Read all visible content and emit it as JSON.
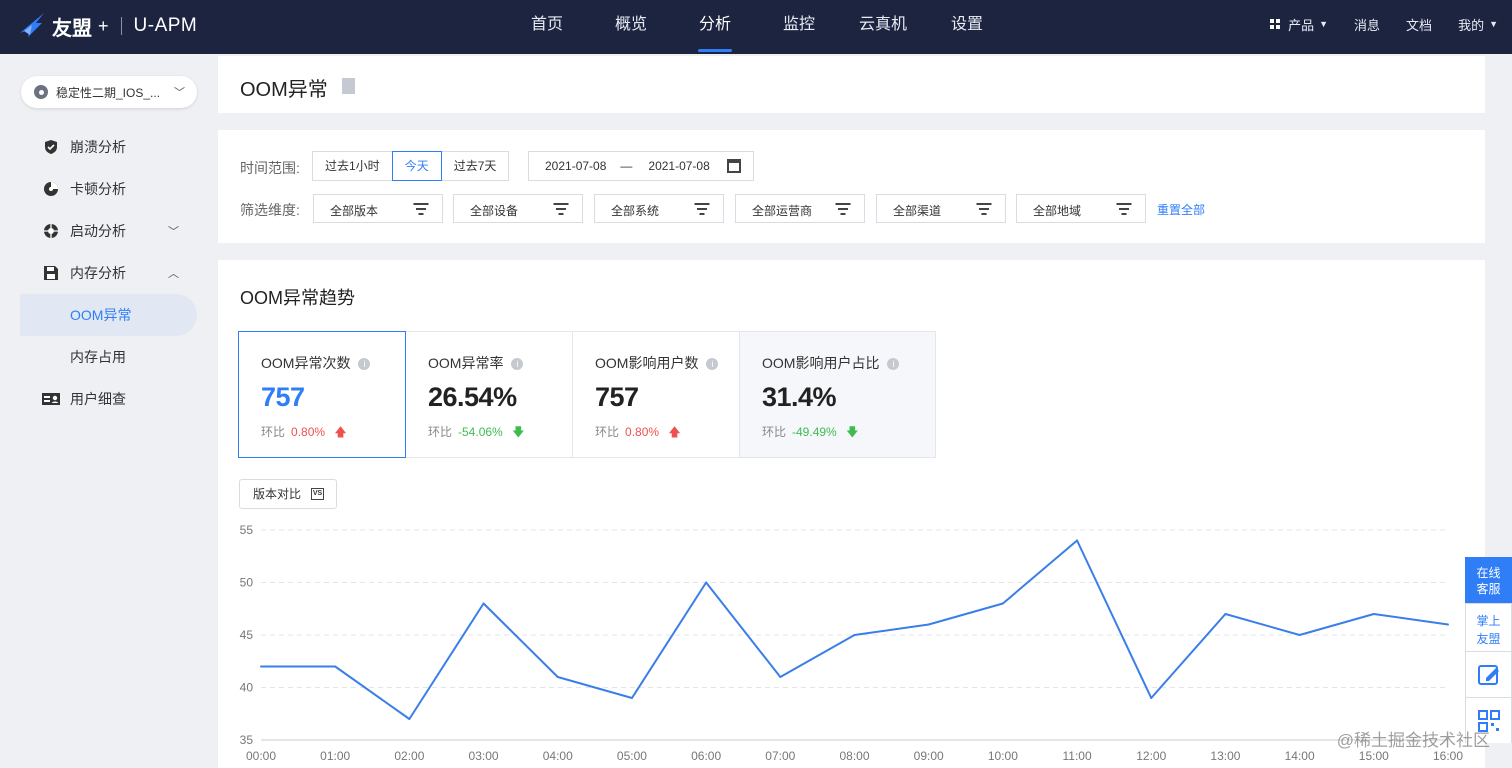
{
  "topbar": {
    "logo": "友盟",
    "logo_plus": "+",
    "app_name": "U-APM",
    "nav": [
      "首页",
      "概览",
      "分析",
      "监控",
      "云真机",
      "设置"
    ],
    "nav_active": "分析",
    "right": {
      "products": "产品",
      "messages": "消息",
      "docs": "文档",
      "mine": "我的"
    }
  },
  "sidebar": {
    "app_selector": "稳定性二期_IOS_...",
    "items": [
      {
        "label": "崩溃分析",
        "icon": "shield-icon"
      },
      {
        "label": "卡顿分析",
        "icon": "pie-icon"
      },
      {
        "label": "启动分析",
        "icon": "aperture-icon"
      },
      {
        "label": "内存分析",
        "icon": "floppy-icon"
      },
      {
        "label": "OOM异常"
      },
      {
        "label": "内存占用"
      },
      {
        "label": "用户细查",
        "icon": "user-card-icon"
      }
    ]
  },
  "page": {
    "title": "OOM异常"
  },
  "filters": {
    "time_label": "时间范围:",
    "time_options": [
      "过去1小时",
      "今天",
      "过去7天"
    ],
    "time_selected": "今天",
    "date_start": "2021-07-08",
    "date_sep": "—",
    "date_end": "2021-07-08",
    "dim_label": "筛选维度:",
    "dimensions": [
      "全部版本",
      "全部设备",
      "全部系统",
      "全部运营商",
      "全部渠道",
      "全部地域"
    ],
    "reset": "重置全部"
  },
  "trend": {
    "title": "OOM异常趋势",
    "compare_label": "版本对比",
    "compare_icon_text": "VS",
    "ratio_label": "环比",
    "cards": [
      {
        "title": "OOM异常次数",
        "value": "757",
        "change": "0.80%",
        "dir": "up"
      },
      {
        "title": "OOM异常率",
        "value": "26.54%",
        "change": "-54.06%",
        "dir": "down"
      },
      {
        "title": "OOM影响用户数",
        "value": "757",
        "change": "0.80%",
        "dir": "up"
      },
      {
        "title": "OOM影响用户占比",
        "value": "31.4%",
        "change": "-49.49%",
        "dir": "down"
      }
    ]
  },
  "chart_data": {
    "type": "line",
    "x": [
      "00:00",
      "01:00",
      "02:00",
      "03:00",
      "04:00",
      "05:00",
      "06:00",
      "07:00",
      "08:00",
      "09:00",
      "10:00",
      "11:00",
      "12:00",
      "13:00",
      "14:00",
      "15:00",
      "16:00"
    ],
    "series": [
      {
        "values": [
          42,
          42,
          37,
          48,
          41,
          39,
          50,
          41,
          45,
          46,
          48,
          54,
          39,
          47,
          45,
          47,
          46
        ],
        "color": "#3a7ee8"
      }
    ],
    "yticks": [
      35,
      40,
      45,
      50,
      55
    ],
    "ylim": [
      35,
      55
    ],
    "grid": true
  },
  "float_tools": {
    "chat": [
      "在线",
      "客服"
    ],
    "mobile": [
      "掌上",
      "友盟"
    ]
  },
  "watermark": "@稀土掘金技术社区",
  "colors": {
    "brand_nav": "#1c2440",
    "accent": "#2f7ef7",
    "up": "#f0504f",
    "down": "#3ebc53"
  }
}
